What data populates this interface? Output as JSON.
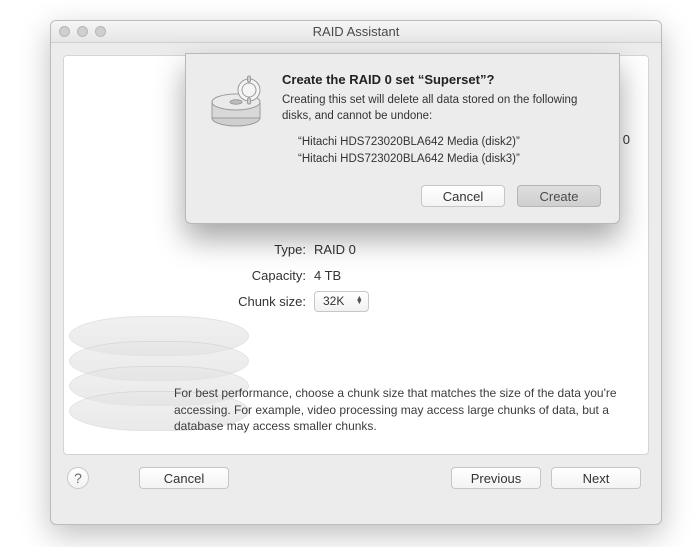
{
  "window": {
    "title": "RAID Assistant"
  },
  "dialog": {
    "title": "Create the RAID 0 set “Superset”?",
    "description": "Creating this set will delete all data stored on the following disks, and cannot be undone:",
    "disks": [
      "“Hitachi HDS723020BLA642 Media (disk2)”",
      "“Hitachi HDS723020BLA642 Media (disk3)”"
    ],
    "cancel_label": "Cancel",
    "create_label": "Create"
  },
  "main": {
    "header_fragment": "e RAID 0",
    "type_label": "Type:",
    "type_value": "RAID 0",
    "capacity_label": "Capacity:",
    "capacity_value": "4 TB",
    "chunk_label": "Chunk size:",
    "chunk_value": "32K",
    "help_text": "For best performance, choose a chunk size that matches the size of the data you're accessing. For example, video processing may access large chunks of data, but a database may access smaller chunks."
  },
  "footer": {
    "help_symbol": "?",
    "cancel_label": "Cancel",
    "previous_label": "Previous",
    "next_label": "Next"
  }
}
